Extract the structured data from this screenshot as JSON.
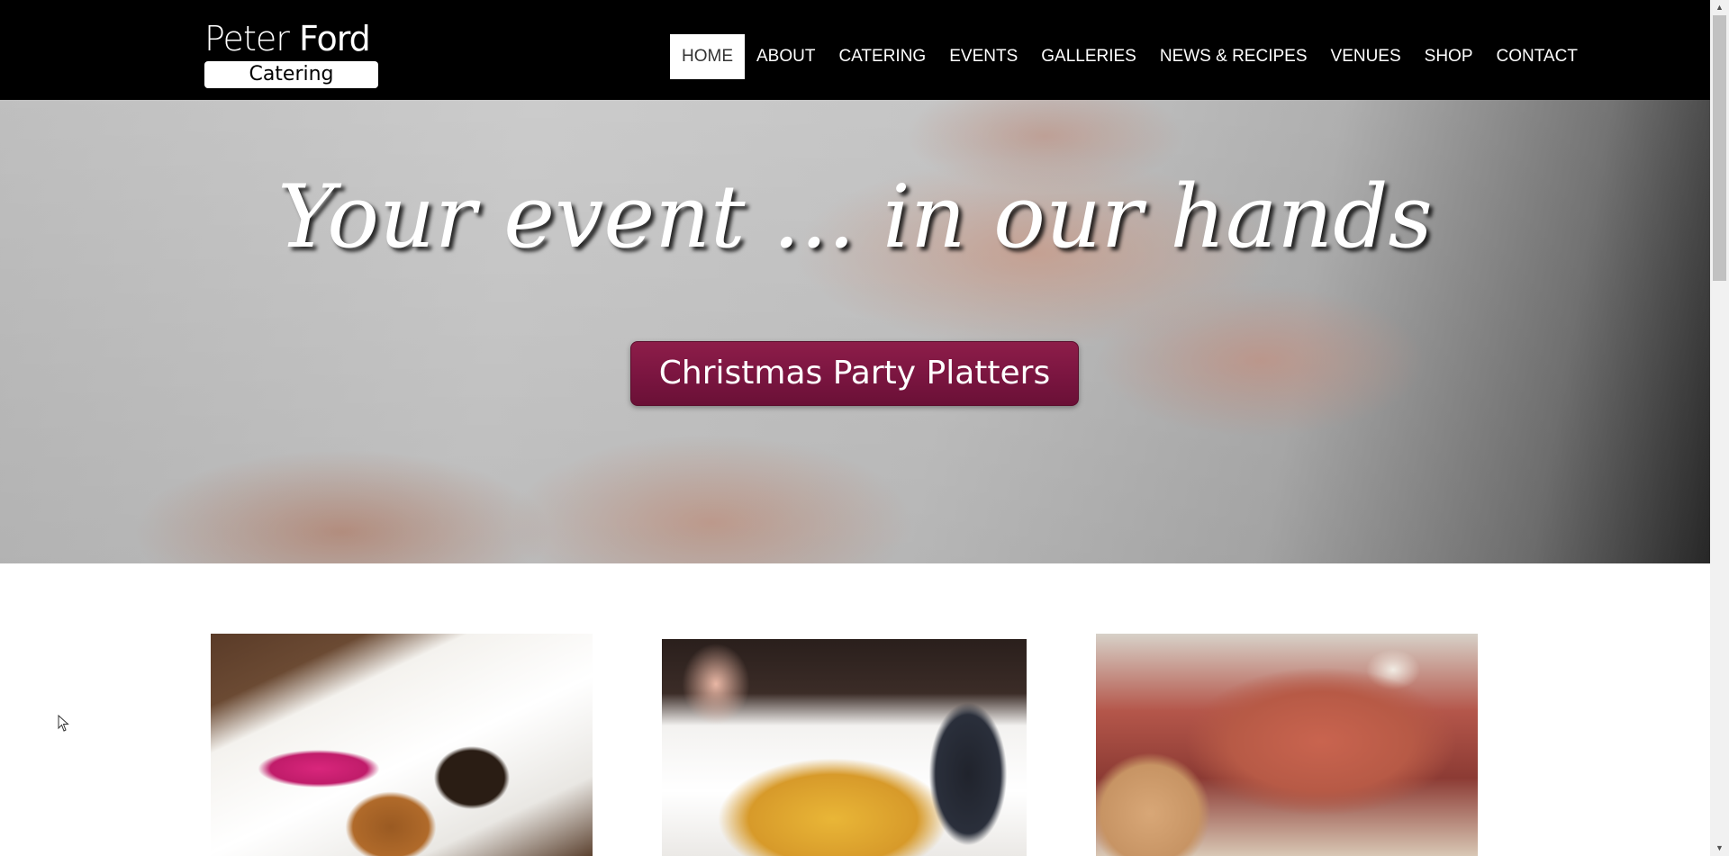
{
  "logo": {
    "line1_thin": "Peter",
    "line1_bold": "Ford",
    "line2": "Catering"
  },
  "nav": {
    "items": [
      "HOME",
      "ABOUT",
      "CATERING",
      "EVENTS",
      "GALLERIES",
      "NEWS & RECIPES",
      "VENUES",
      "SHOP",
      "CONTACT"
    ],
    "active": "HOME"
  },
  "hero": {
    "title": "Your event ... in our hands",
    "button_label": "Christmas Party Platters"
  },
  "colors": {
    "header_bg": "#000000",
    "button_accent": "#7a1540"
  },
  "cards": [
    {
      "image": "food-plate-image"
    },
    {
      "image": "paella-dish-image"
    },
    {
      "image": "seafood-platter-image"
    }
  ]
}
